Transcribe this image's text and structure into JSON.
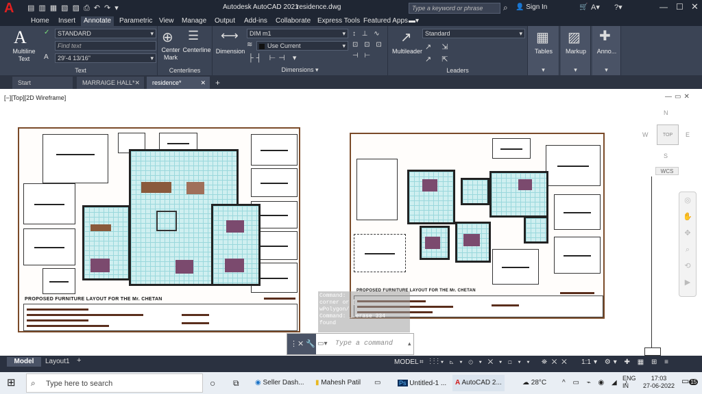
{
  "titlebar": {
    "app_title": "Autodesk AutoCAD 2021",
    "file_name": "residence.dwg",
    "search_placeholder": "Type a keyword or phrase",
    "sign_in": "Sign In",
    "logo_letter": "A"
  },
  "ribbon_tabs": [
    "Home",
    "Insert",
    "Annotate",
    "Parametric",
    "View",
    "Manage",
    "Output",
    "Add-ins",
    "Collaborate",
    "Express Tools",
    "Featured Apps"
  ],
  "ribbon": {
    "text_panel": {
      "big_button": "Multiline Text",
      "style": "STANDARD",
      "find_placeholder": "Find text",
      "height": "29'-4 13/16\"",
      "label": "Text"
    },
    "centerlines_panel": {
      "center_mark": "Center Mark",
      "centerline": "Centerline",
      "label": "Centerlines"
    },
    "dimensions_panel": {
      "dimension": "Dimension",
      "dim_style": "DIM m1",
      "layer": "Use Current",
      "label": "Dimensions"
    },
    "leaders_panel": {
      "multileader": "Multileader",
      "style": "Standard",
      "label": "Leaders"
    },
    "tables": "Tables",
    "markup": "Markup",
    "annotation": "Anno..."
  },
  "doc_tabs": [
    {
      "label": "Start"
    },
    {
      "label": "MARRAIGE HALL*"
    },
    {
      "label": "residence*"
    }
  ],
  "viewport": {
    "label": "[−][Top][2D Wireframe]",
    "compass": {
      "n": "N",
      "s": "S",
      "e": "E",
      "w": "W",
      "top": "TOP",
      "wcs": "WCS"
    }
  },
  "drawing": {
    "left_title": "PROPOSED FURNITURE LAYOUT FOR THE Mr. CHETAN",
    "right_title": "PROPOSED FURNITURE LAYOUT FOR THE Mr. CHETAN"
  },
  "command": {
    "history": [
      "Command:",
      "corner or [",
      "wPolygon/",
      "Command: _.erase 334",
      "found"
    ],
    "placeholder": "Type a command"
  },
  "layout_tabs": [
    "Model",
    "Layout1"
  ],
  "statusbar": {
    "model": "MODEL",
    "scale": "1:1"
  },
  "taskbar": {
    "search_placeholder": "Type here to search",
    "apps": [
      "Seller Dash...",
      "Mahesh Patil",
      "Untitled-1 ...",
      "AutoCAD 2..."
    ],
    "temperature": "28°C",
    "lang": "ENG",
    "region": "IN",
    "time": "17:03",
    "date": "27-06-2022",
    "notifications": "15"
  }
}
